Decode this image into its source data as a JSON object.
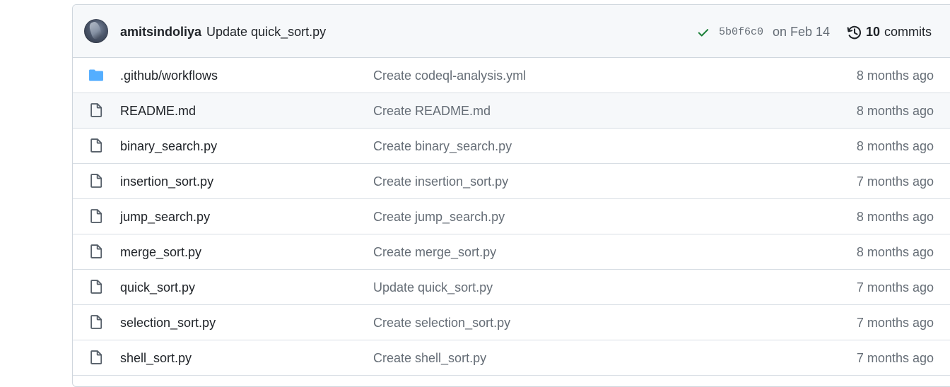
{
  "commit": {
    "author": "amitsindoliya",
    "message": "Update quick_sort.py",
    "sha": "5b0f6c0",
    "date": "on Feb 14",
    "commits_count": "10",
    "commits_label": "commits"
  },
  "colors": {
    "folder": "#54aeff",
    "check": "#1a7f37",
    "border": "#d0d7de",
    "muted_text": "#656d76"
  },
  "files": [
    {
      "type": "folder",
      "icon": "folder-icon",
      "name": ".github/workflows",
      "message": "Create codeql-analysis.yml",
      "age": "8 months ago"
    },
    {
      "type": "file",
      "icon": "file-icon",
      "name": "README.md",
      "message": "Create README.md",
      "age": "8 months ago"
    },
    {
      "type": "file",
      "icon": "file-icon",
      "name": "binary_search.py",
      "message": "Create binary_search.py",
      "age": "8 months ago"
    },
    {
      "type": "file",
      "icon": "file-icon",
      "name": "insertion_sort.py",
      "message": "Create insertion_sort.py",
      "age": "7 months ago"
    },
    {
      "type": "file",
      "icon": "file-icon",
      "name": "jump_search.py",
      "message": "Create jump_search.py",
      "age": "8 months ago"
    },
    {
      "type": "file",
      "icon": "file-icon",
      "name": "merge_sort.py",
      "message": "Create merge_sort.py",
      "age": "8 months ago"
    },
    {
      "type": "file",
      "icon": "file-icon",
      "name": "quick_sort.py",
      "message": "Update quick_sort.py",
      "age": "7 months ago"
    },
    {
      "type": "file",
      "icon": "file-icon",
      "name": "selection_sort.py",
      "message": "Create selection_sort.py",
      "age": "7 months ago"
    },
    {
      "type": "file",
      "icon": "file-icon",
      "name": "shell_sort.py",
      "message": "Create shell_sort.py",
      "age": "7 months ago"
    }
  ]
}
